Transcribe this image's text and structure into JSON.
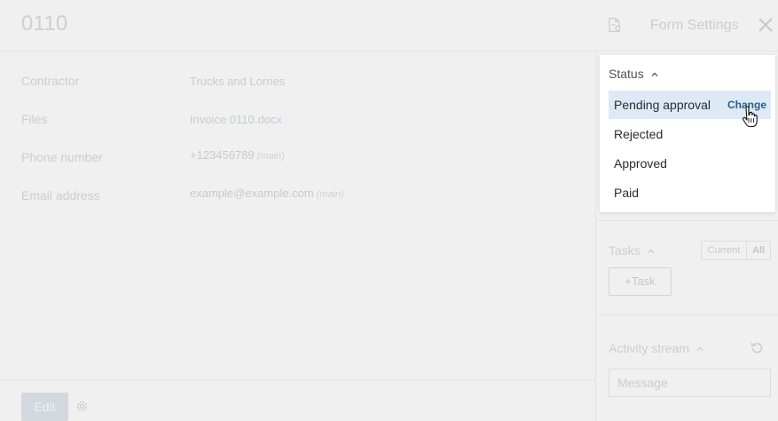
{
  "header": {
    "title": "0110",
    "form_settings": "Form Settings"
  },
  "fields": [
    {
      "label": "Contractor",
      "value": "Trucks and Lorries",
      "tag": ""
    },
    {
      "label": "Files",
      "value": "Invoice 0110.docx",
      "tag": ""
    },
    {
      "label": "Phone number",
      "value": "+123456789",
      "tag": "(main)"
    },
    {
      "label": "Email address",
      "value": "example@example.com",
      "tag": "(main)"
    }
  ],
  "footer": {
    "edit_label": "Edit"
  },
  "status": {
    "header": "Status",
    "items": [
      {
        "label": "Pending approval",
        "active": true
      },
      {
        "label": "Rejected",
        "active": false
      },
      {
        "label": "Approved",
        "active": false
      },
      {
        "label": "Paid",
        "active": false
      }
    ],
    "change_label": "Change"
  },
  "tasks": {
    "title": "Tasks",
    "filter_current": "Current",
    "filter_all": "All",
    "selected_filter": "All",
    "add_task": "+Task"
  },
  "activity": {
    "title": "Activity stream",
    "message_placeholder": "Message"
  },
  "colors": {
    "active_row": "#ddeaf6",
    "change_link": "#2f5d86",
    "edit_button": "#d2d8de"
  },
  "icons": [
    "document-settings-icon",
    "close-icon",
    "gear-icon",
    "chevron-up-icon",
    "undo-icon",
    "hand-cursor-icon"
  ]
}
